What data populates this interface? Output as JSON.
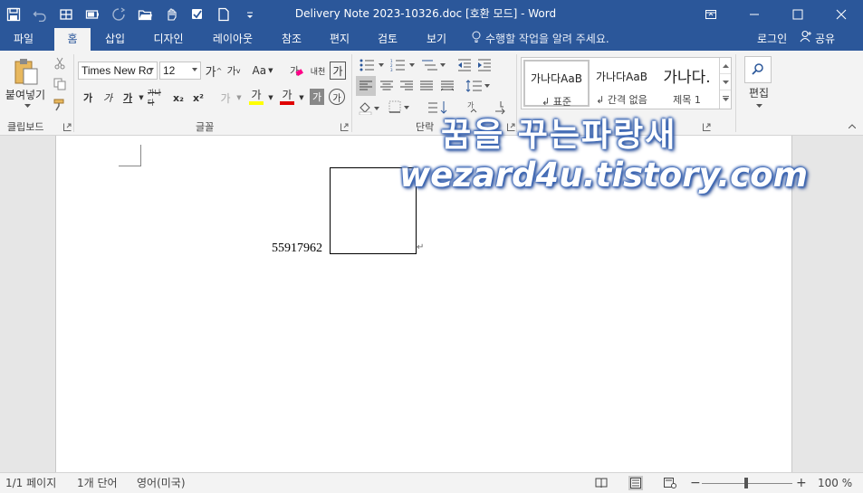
{
  "window": {
    "title": "Delivery Note 2023-10326.doc [호환 모드] - Word"
  },
  "tabs": [
    {
      "label": "파일"
    },
    {
      "label": "홈"
    },
    {
      "label": "삽입"
    },
    {
      "label": "디자인"
    },
    {
      "label": "레이아웃"
    },
    {
      "label": "참조"
    },
    {
      "label": "편지"
    },
    {
      "label": "검토"
    },
    {
      "label": "보기"
    }
  ],
  "tell_me": "수행할 작업을 알려 주세요.",
  "account": {
    "signin": "로그인",
    "share": "공유"
  },
  "ribbon": {
    "clipboard": {
      "paste_label": "붙여넣기",
      "group_label": "클립보드"
    },
    "font": {
      "font_name": "Times New Ro",
      "font_size": "12",
      "grow": "가",
      "shrink": "가",
      "case": "Aa",
      "phonetic": "내천",
      "char_border": "가",
      "bold": "가",
      "italic": "가",
      "underline": "가",
      "strike": "가나다",
      "subscript": "x₂",
      "superscript": "x²",
      "effects": "가",
      "highlight": "가",
      "font_color": "가",
      "char_shading": "가",
      "enclose": "가",
      "group_label": "글꼴"
    },
    "paragraph": {
      "group_label": "단락"
    },
    "styles": {
      "items": [
        {
          "sample": "가나다AaB",
          "name": "↲ 표준"
        },
        {
          "sample": "가나다AaB",
          "name": "↲ 간격 없음"
        },
        {
          "sample": "가나다.",
          "name": "제목 1"
        }
      ]
    },
    "editing": {
      "label": "편집"
    }
  },
  "document": {
    "number_text": "55917962",
    "para_mark": "↵"
  },
  "watermark": {
    "line1": "꿈을 꾸는파랑새",
    "line2": "wezard4u.tistory.com"
  },
  "status": {
    "page": "1/1 페이지",
    "words": "1개 단어",
    "language": "영어(미국)",
    "zoom_minus": "−",
    "zoom_plus": "+",
    "zoom_level": "100 %"
  },
  "colors": {
    "title_bar": "#2b579a",
    "ribbon": "#f3f3f3",
    "highlight_yellow": "#ffff00",
    "font_red": "#e00000"
  }
}
